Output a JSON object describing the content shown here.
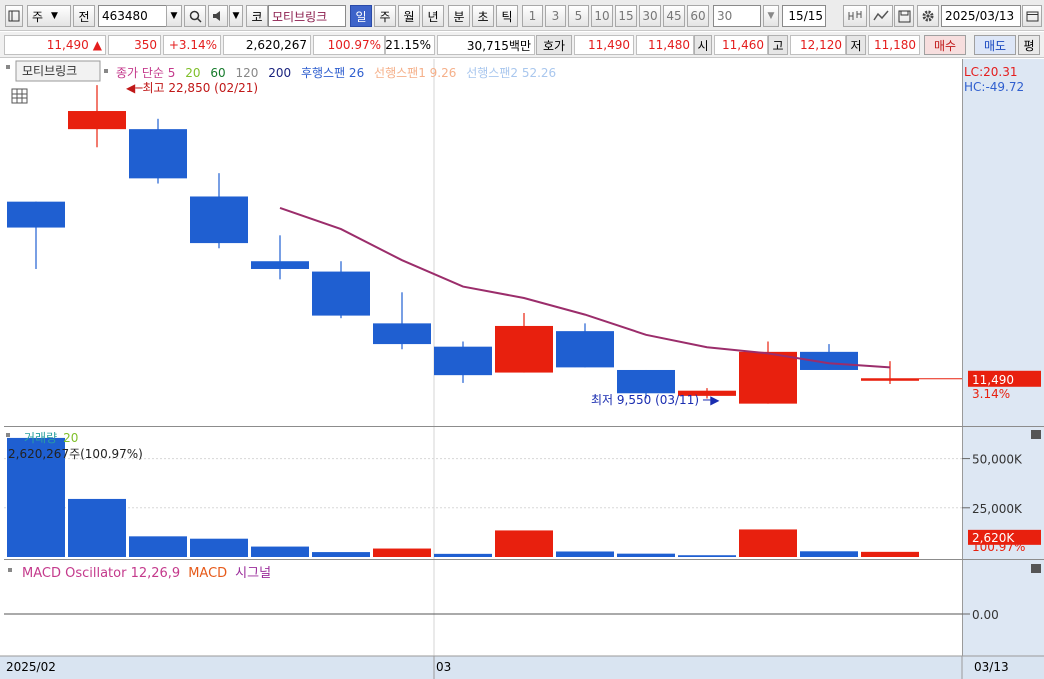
{
  "toolbar": {
    "period_mode": "주",
    "tab_jeon": "전",
    "code": "463480",
    "code_kr": "코",
    "stock_name": "모티브링크",
    "periods": [
      "일",
      "주",
      "월",
      "년",
      "분",
      "초",
      "틱"
    ],
    "minute_values": [
      "1",
      "3",
      "5",
      "10",
      "15",
      "30",
      "45",
      "60"
    ],
    "minute_combo": "30",
    "page_count": "15",
    "page_total": "/15",
    "date": "2025/03/13",
    "side_tab": "평"
  },
  "quote": {
    "price": "11,490",
    "change": "350",
    "change_pct": "+3.14%",
    "volume": "2,620,267",
    "vol_ratio": "100.97%",
    "turnover": "21.15%",
    "amount": "30,715백만",
    "bid_label": "호가",
    "ask": "11,490",
    "bid": "11,480",
    "open_label": "시",
    "open": "11,460",
    "high_label": "고",
    "high": "12,120",
    "low_label": "저",
    "low": "11,180",
    "buy_label": "매수",
    "sell_label": "매도"
  },
  "chart_data": [
    {
      "type": "candlestick",
      "name_label": "모티브링크",
      "indicators": [
        "종가 단순 5",
        "20",
        "60",
        "120",
        "200",
        "후행스팬 26",
        "선행스팬1 9.26",
        "선행스팬2 52.26"
      ],
      "indicator_colors": [
        "#c43a8c",
        "#7fbf2a",
        "#157a2a",
        "#888888",
        "#1a237e",
        "#2f5fcf",
        "#f5b08a",
        "#a9c7ee"
      ],
      "right_labels": [
        "LC:20.31",
        "HC:-49.72"
      ],
      "candles": [
        {
          "o": 15200,
          "h": 15200,
          "l": 13900,
          "c": 14700
        },
        {
          "o": 16600,
          "h": 17450,
          "l": 16250,
          "c": 16950
        },
        {
          "o": 16600,
          "h": 16800,
          "l": 15550,
          "c": 15650
        },
        {
          "o": 15300,
          "h": 15750,
          "l": 14300,
          "c": 14400
        },
        {
          "o": 14050,
          "h": 14550,
          "l": 13700,
          "c": 13900
        },
        {
          "o": 13850,
          "h": 14050,
          "l": 12950,
          "c": 13000
        },
        {
          "o": 12850,
          "h": 13450,
          "l": 12350,
          "c": 12450
        },
        {
          "o": 12400,
          "h": 12500,
          "l": 11700,
          "c": 11850
        },
        {
          "o": 11900,
          "h": 13050,
          "l": 11900,
          "c": 12800
        },
        {
          "o": 12700,
          "h": 12850,
          "l": 12000,
          "c": 12000
        },
        {
          "o": 11950,
          "h": 11950,
          "l": 11400,
          "c": 11500
        },
        {
          "o": 11450,
          "h": 11600,
          "l": 11400,
          "c": 11550
        },
        {
          "o": 11300,
          "h": 12500,
          "l": 11300,
          "c": 12300
        },
        {
          "o": 12300,
          "h": 12450,
          "l": 11950,
          "c": 11950
        },
        {
          "o": 11780,
          "h": 12120,
          "l": 11680,
          "c": 11780
        }
      ],
      "ma5": [
        null,
        null,
        null,
        null,
        15080,
        14670,
        14070,
        13560,
        13340,
        13020,
        12630,
        12390,
        12270,
        12080,
        12000
      ],
      "ma_color": "#9b2d6b",
      "max_label": "최고 22,850 (02/21)",
      "min_label": "최저 9,550 (03/11)",
      "last_price": "11,490",
      "last_pct": "3.14%"
    },
    {
      "type": "bar",
      "title": "거래량",
      "period": "20",
      "summary": "2,620,267주(100.97%)",
      "values": [
        60500,
        29500,
        10500,
        9300,
        5300,
        2500,
        4300,
        1600,
        13500,
        2800,
        1700,
        900,
        14000,
        2900,
        2620
      ],
      "colors": [
        "b",
        "b",
        "b",
        "b",
        "b",
        "b",
        "r",
        "b",
        "r",
        "b",
        "b",
        "b",
        "r",
        "b",
        "r"
      ],
      "ylim": [
        0,
        63000
      ],
      "ticks": [
        "50,000K",
        "25,000K"
      ],
      "last_label": "2,620K",
      "last_pct": "100.97%"
    },
    {
      "type": "line",
      "title": "MACD Oscillator 12,26,9",
      "series_names": [
        "MACD",
        "시그널"
      ],
      "series_colors": [
        "#e65a1a",
        "#9b2d9b"
      ],
      "zero_label": "0.00"
    }
  ],
  "xaxis": {
    "left": "2025/02",
    "mid": "03",
    "right": "03/13"
  }
}
